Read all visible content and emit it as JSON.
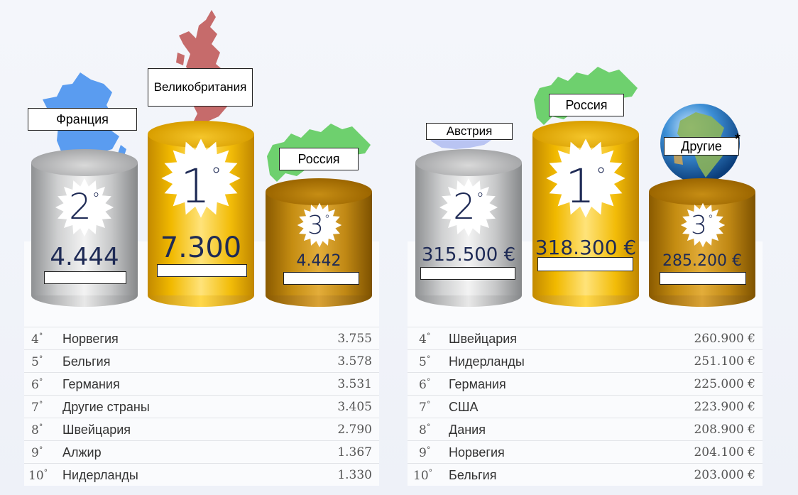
{
  "chart_data": [
    {
      "type": "bar",
      "podium": [
        {
          "place": "2",
          "country": "Франция",
          "value_label": "4.444",
          "value": 4444
        },
        {
          "place": "1",
          "country": "Великобритания",
          "value_label": "7.300",
          "value": 7300
        },
        {
          "place": "3",
          "country": "Россия",
          "value_label": "4.442",
          "value": 4442
        }
      ],
      "rows": [
        {
          "place": "4",
          "country": "Норвегия",
          "value_label": "3.755",
          "value": 3755
        },
        {
          "place": "5",
          "country": "Бельгия",
          "value_label": "3.578",
          "value": 3578
        },
        {
          "place": "6",
          "country": "Германия",
          "value_label": "3.531",
          "value": 3531
        },
        {
          "place": "7",
          "country": "Другие страны",
          "value_label": "3.405",
          "value": 3405
        },
        {
          "place": "8",
          "country": "Швейцария",
          "value_label": "2.790",
          "value": 2790
        },
        {
          "place": "9",
          "country": "Алжир",
          "value_label": "1.367",
          "value": 1367
        },
        {
          "place": "10",
          "country": "Нидерланды",
          "value_label": "1.330",
          "value": 1330
        }
      ]
    },
    {
      "type": "bar",
      "podium": [
        {
          "place": "2",
          "country": "Австрия",
          "value_label": "315.500 €",
          "value": 315500
        },
        {
          "place": "1",
          "country": "Россия",
          "value_label": "318.300 €",
          "value": 318300
        },
        {
          "place": "3",
          "country": "Другие",
          "value_label": "285.200 €",
          "value": 285200
        }
      ],
      "rows": [
        {
          "place": "4",
          "country": "Швейцария",
          "value_label": "260.900 €",
          "value": 260900
        },
        {
          "place": "5",
          "country": "Нидерланды",
          "value_label": "251.100 €",
          "value": 251100
        },
        {
          "place": "6",
          "country": "Германия",
          "value_label": "225.000 €",
          "value": 225000
        },
        {
          "place": "7",
          "country": "США",
          "value_label": "223.900 €",
          "value": 223900
        },
        {
          "place": "8",
          "country": "Дания",
          "value_label": "208.900 €",
          "value": 208900
        },
        {
          "place": "9",
          "country": "Норвегия",
          "value_label": "204.100 €",
          "value": 204100
        },
        {
          "place": "10",
          "country": "Бельгия",
          "value_label": "203.000 €",
          "value": 203000
        }
      ]
    }
  ],
  "degree_sign": "°",
  "asterisk": "*",
  "colors": {
    "silver": "#c7c8c9",
    "gold": "#f1b900",
    "bronze": "#c58d12",
    "text": "#1e2a55"
  }
}
